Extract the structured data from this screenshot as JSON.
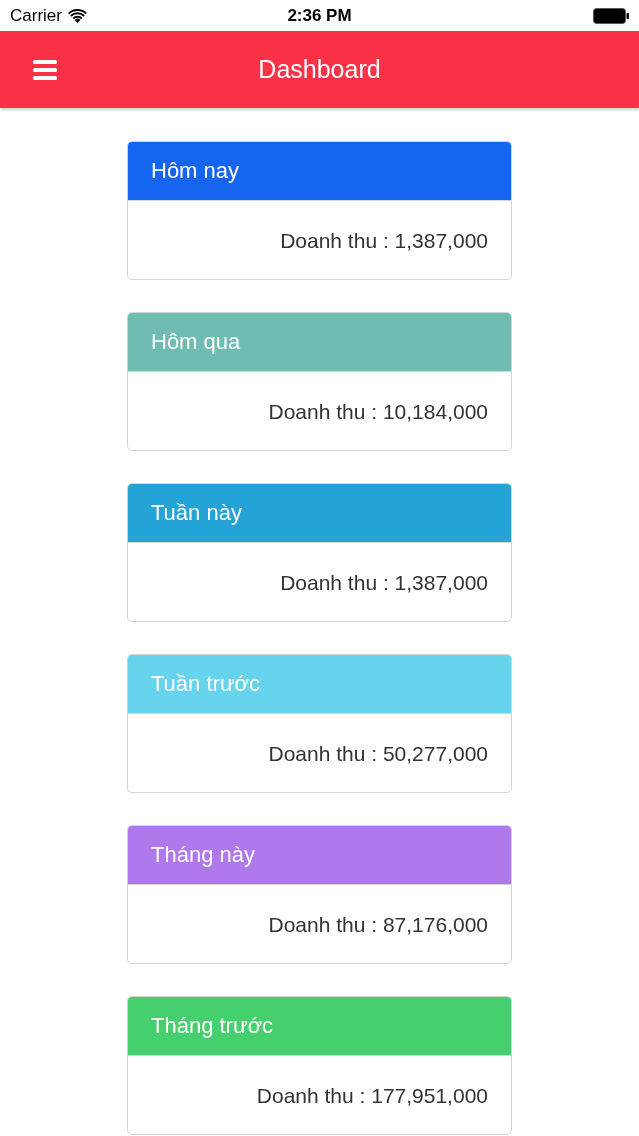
{
  "status_bar": {
    "carrier": "Carrier",
    "time": "2:36 PM"
  },
  "header": {
    "title": "Dashboard"
  },
  "cards": [
    {
      "title": "Hôm nay",
      "color": "#1565f0",
      "revenue": "Doanh thu : 1,387,000"
    },
    {
      "title": "Hôm qua",
      "color": "#6fbcb3",
      "revenue": "Doanh thu : 10,184,000"
    },
    {
      "title": "Tuần này",
      "color": "#23a3d6",
      "revenue": "Doanh thu : 1,387,000"
    },
    {
      "title": "Tuần trước",
      "color": "#67d4ee",
      "revenue": "Doanh thu : 50,277,000"
    },
    {
      "title": "Tháng này",
      "color": "#af78ec",
      "revenue": "Doanh thu : 87,176,000"
    },
    {
      "title": "Tháng trước",
      "color": "#46cf6e",
      "revenue": "Doanh thu : 177,951,000"
    }
  ]
}
